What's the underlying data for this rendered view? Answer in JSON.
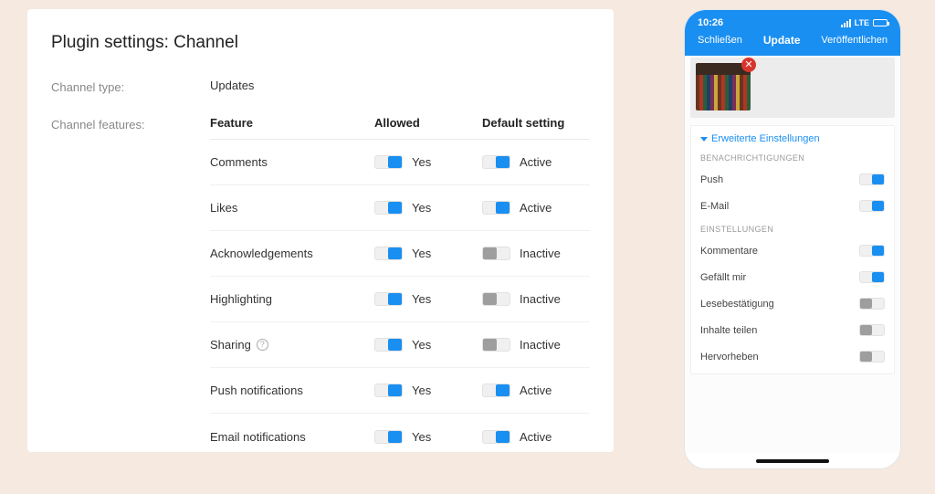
{
  "settings": {
    "title": "Plugin settings: Channel",
    "channelType": {
      "label": "Channel type:",
      "value": "Updates"
    },
    "channelFeaturesLabel": "Channel features:",
    "columns": {
      "feature": "Feature",
      "allowed": "Allowed",
      "default": "Default setting"
    },
    "toggleText": {
      "yes": "Yes",
      "active": "Active",
      "inactive": "Inactive"
    },
    "features": [
      {
        "name": "Comments",
        "allowed": true,
        "defaultActive": true
      },
      {
        "name": "Likes",
        "allowed": true,
        "defaultActive": true
      },
      {
        "name": "Acknowledgements",
        "allowed": true,
        "defaultActive": false
      },
      {
        "name": "Highlighting",
        "allowed": true,
        "defaultActive": false
      },
      {
        "name": "Sharing",
        "allowed": true,
        "defaultActive": false,
        "help": true
      },
      {
        "name": "Push notifications",
        "allowed": true,
        "defaultActive": true
      },
      {
        "name": "Email notifications",
        "allowed": true,
        "defaultActive": true
      }
    ]
  },
  "phone": {
    "status": {
      "time": "10:26",
      "network": "LTE"
    },
    "nav": {
      "left": "Schließen",
      "center": "Update",
      "right": "Veröffentlichen"
    },
    "advanced": {
      "link": "Erweiterte Einstellungen"
    },
    "groups": [
      {
        "title": "BENACHRICHTIGUNGEN",
        "options": [
          {
            "label": "Push",
            "on": true
          },
          {
            "label": "E-Mail",
            "on": true
          }
        ]
      },
      {
        "title": "EINSTELLUNGEN",
        "options": [
          {
            "label": "Kommentare",
            "on": true
          },
          {
            "label": "Gefällt mir",
            "on": true
          },
          {
            "label": "Lesebestätigung",
            "on": false
          },
          {
            "label": "Inhalte teilen",
            "on": false
          },
          {
            "label": "Hervorheben",
            "on": false
          }
        ]
      }
    ]
  }
}
